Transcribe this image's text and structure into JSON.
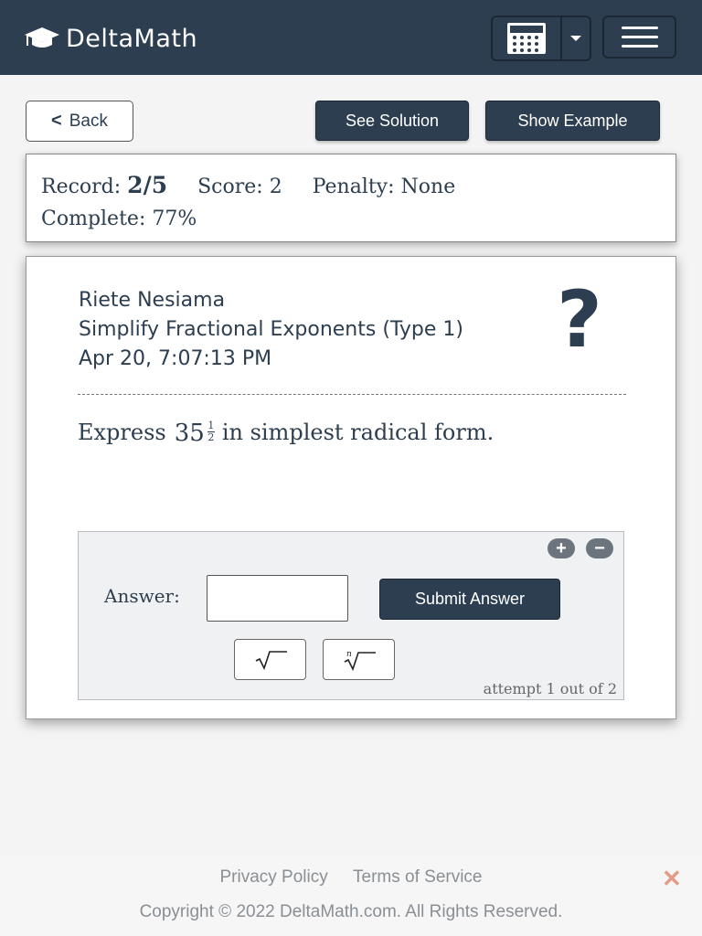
{
  "navbar": {
    "brand": "DeltaMath",
    "icons": {
      "logo": "graduation-cap-icon",
      "calculator": "calculator-icon",
      "dropdown": "caret-down-icon",
      "menu": "hamburger-menu-icon"
    }
  },
  "actions": {
    "back": "Back",
    "see_solution": "See Solution",
    "show_example": "Show Example"
  },
  "record": {
    "record_label": "Record:",
    "record_value": "2/5",
    "score_label": "Score:",
    "score_value": "2",
    "penalty_label": "Penalty:",
    "penalty_value": "None",
    "complete_label": "Complete:",
    "complete_value": "77%"
  },
  "problem": {
    "student": "Riete Nesiama",
    "skill": "Simplify Fractional Exponents (Type 1)",
    "timestamp": "Apr 20, 7:07:13 PM",
    "help_icon": "?",
    "prompt_before": "Express",
    "base": "35",
    "exp_num": "1",
    "exp_den": "2",
    "prompt_after": "in simplest radical form."
  },
  "answer": {
    "label": "Answer:",
    "value": "",
    "submit": "Submit Answer",
    "zoom_in": "+",
    "zoom_out": "−",
    "attempt": "attempt 1 out of 2"
  },
  "footer": {
    "privacy": "Privacy Policy",
    "terms": "Terms of Service",
    "copyright": "Copyright © 2022 DeltaMath.com. All Rights Reserved.",
    "close": "✕"
  },
  "colors": {
    "primary": "#2c3e50",
    "background": "#f4f4f4",
    "close": "#e49b85"
  }
}
